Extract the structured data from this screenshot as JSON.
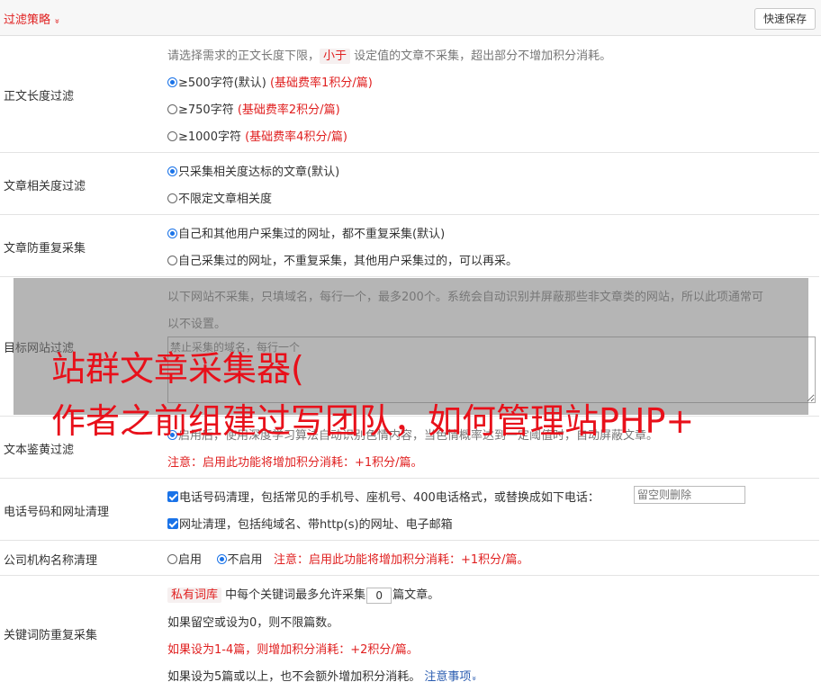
{
  "header": {
    "title": "过滤策略",
    "chevron": "»",
    "save_button": "快速保存"
  },
  "length_filter": {
    "label": "正文长度过滤",
    "desc_pre": "请选择需求的正文长度下限，",
    "desc_tag": "小于",
    "desc_post": " 设定值的文章不采集，超出部分不增加积分消耗。",
    "options": [
      {
        "label": "≥500字符(默认) ",
        "note": "(基础费率1积分/篇)",
        "checked": true
      },
      {
        "label": "≥750字符 ",
        "note": "(基础费率2积分/篇)",
        "checked": false
      },
      {
        "label": "≥1000字符 ",
        "note": "(基础费率4积分/篇)",
        "checked": false
      }
    ]
  },
  "relevance_filter": {
    "label": "文章相关度过滤",
    "options": [
      {
        "label": "只采集相关度达标的文章(默认)",
        "checked": true
      },
      {
        "label": "不限定文章相关度",
        "checked": false
      }
    ]
  },
  "dedup": {
    "label": "文章防重复采集",
    "options": [
      {
        "label": "自己和其他用户采集过的网址，都不重复采集(默认)",
        "checked": true
      },
      {
        "label": "自己采集过的网址，不重复采集，其他用户采集过的，可以再采。",
        "checked": false
      }
    ]
  },
  "site_filter": {
    "label": "目标网站过滤",
    "desc_line1": "以下网站不采集，只填域名，每行一个，最多200个。系统会自动识别并屏蔽那些非文章类的网站，所以此项通常可",
    "desc_line2": "以不设置。",
    "placeholder": "禁止采集的域名，每行一个"
  },
  "porn_filter": {
    "label": "文本鉴黄过滤",
    "desc": "启用后，使用深度学习算法自动识别色情内容，当色情概率达到一定阈值时，自动屏蔽文章。",
    "note": "注意：启用此功能将增加积分消耗：+1积分/篇。"
  },
  "phone_clean": {
    "label": "电话号码和网址清理",
    "phone_text": "电话号码清理，包括常见的手机号、座机号、400电话格式，或替换成如下电话：",
    "phone_placeholder": "留空则删除",
    "url_text": "网址清理，包括纯域名、带http(s)的网址、电子邮箱"
  },
  "company_clean": {
    "label": "公司机构名称清理",
    "enable": "启用",
    "disable": "不启用",
    "note": "注意：启用此功能将增加积分消耗：+1积分/篇。"
  },
  "keyword_dedup": {
    "label": "关键词防重复采集",
    "tag": "私有词库",
    "line1_pre": " 中每个关键词最多允许采集",
    "count": "0",
    "line1_post": "篇文章。",
    "line2": "如果留空或设为0，则不限篇数。",
    "line3": "如果设为1-4篇，则增加积分消耗：+2积分/篇。",
    "line4": "如果设为5篇或以上，也不会额外增加积分消耗。 ",
    "notice_link": "注意事项",
    "notice_chevron": "»"
  },
  "watermark": {
    "line1": "站群文章采集器(",
    "line2": "作者之前组建过写团队，如何管理站PHP+"
  },
  "colors": {
    "accent_red": "#e02020",
    "link_blue": "#2a5cb0",
    "control_blue": "#1a73e8",
    "watermark_red": "#e8101a"
  }
}
